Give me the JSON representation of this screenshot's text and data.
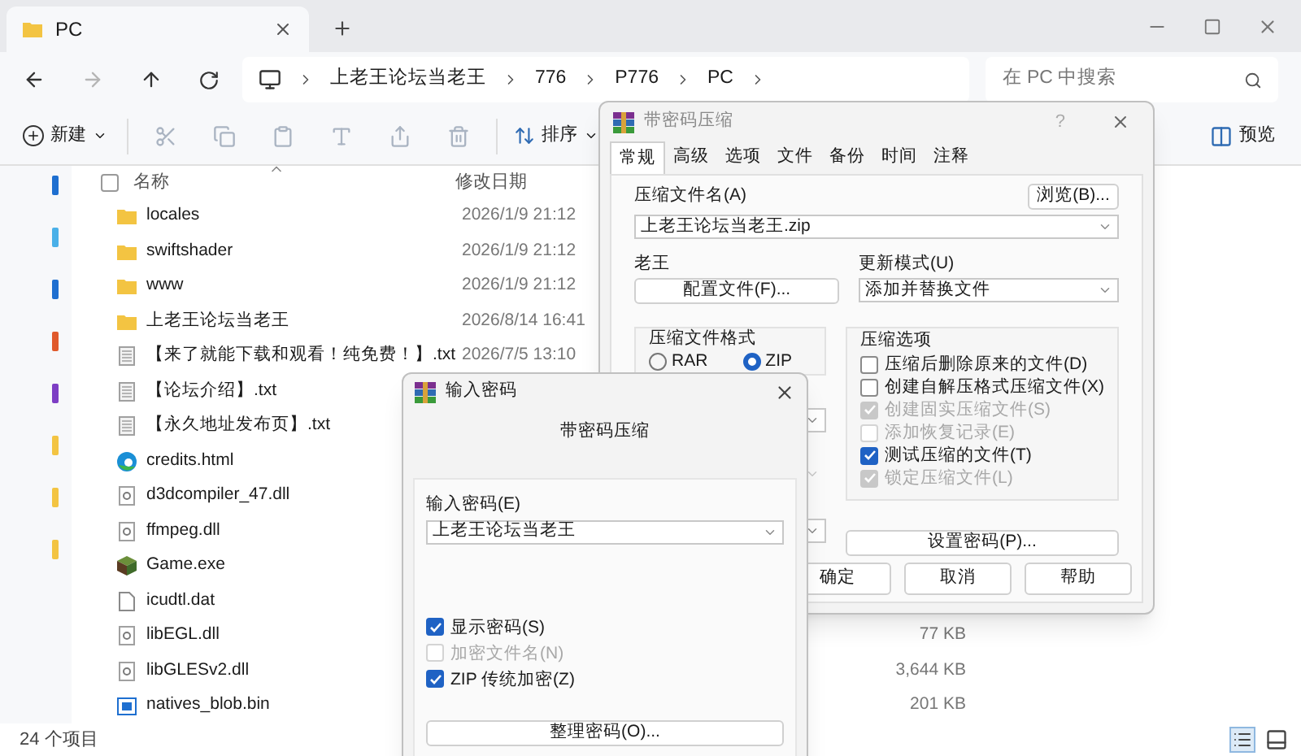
{
  "explorer": {
    "tab": {
      "title": "PC"
    },
    "address": {
      "path": [
        "上老王论坛当老王",
        "776",
        "P776",
        "PC"
      ]
    },
    "search": {
      "placeholder": "在 PC 中搜索"
    },
    "toolbar": {
      "new_label": "新建",
      "sort_label": "排序",
      "preview_label": "预览"
    },
    "select_all": {
      "checked": false
    },
    "columns": [
      "名称",
      "修改日期"
    ],
    "files": [
      {
        "name": "locales",
        "kind": "folder",
        "date": "2026/1/9 21:12"
      },
      {
        "name": "swiftshader",
        "kind": "folder",
        "date": "2026/1/9 21:12"
      },
      {
        "name": "www",
        "kind": "folder",
        "date": "2026/1/9 21:12"
      },
      {
        "name": "上老王论坛当老王",
        "kind": "folder",
        "date": "2026/8/14 16:41"
      },
      {
        "name": "【来了就能下载和观看！纯免费！】.txt",
        "kind": "text",
        "date": "2026/7/5 13:10"
      },
      {
        "name": "【论坛介绍】.txt",
        "kind": "text"
      },
      {
        "name": "【永久地址发布页】.txt",
        "kind": "text"
      },
      {
        "name": "credits.html",
        "kind": "web"
      },
      {
        "name": "d3dcompiler_47.dll",
        "kind": "dll"
      },
      {
        "name": "ffmpeg.dll",
        "kind": "dll"
      },
      {
        "name": "Game.exe",
        "kind": "exe"
      },
      {
        "name": "icudtl.dat",
        "kind": "blank"
      },
      {
        "name": "libEGL.dll",
        "kind": "dll",
        "size": "77 KB"
      },
      {
        "name": "libGLESv2.dll",
        "kind": "dll",
        "size": "3,644 KB"
      },
      {
        "name": "natives_blob.bin",
        "kind": "bin",
        "size": "201 KB"
      }
    ],
    "status": "24 个项目"
  },
  "archive_dialog": {
    "title": "带密码压缩",
    "help_glyph": "?",
    "tabs": [
      {
        "label": "常规",
        "selected": true
      },
      {
        "label": "高级",
        "selected": false
      },
      {
        "label": "选项",
        "selected": false
      },
      {
        "label": "文件",
        "selected": false
      },
      {
        "label": "备份",
        "selected": false
      },
      {
        "label": "时间",
        "selected": false
      },
      {
        "label": "注释",
        "selected": false
      }
    ],
    "archive_name_label": "压缩文件名(A)",
    "browse_button": "浏览(B)...",
    "archive_name": "上老王论坛当老王.zip",
    "profile_label": "老王",
    "profile_button": "配置文件(F)...",
    "update_label": "更新模式(U)",
    "update_mode": "添加并替换文件",
    "format_label": "压缩文件格式",
    "formats": [
      {
        "label": "RAR",
        "selected": false
      },
      {
        "label": "ZIP",
        "selected": true
      }
    ],
    "options_label": "压缩选项",
    "options": [
      {
        "label": "压缩后删除原来的文件(D)",
        "checked": false,
        "disabled": false
      },
      {
        "label": "创建自解压格式压缩文件(X)",
        "checked": false,
        "disabled": false
      },
      {
        "label": "创建固实压缩文件(S)",
        "checked": true,
        "disabled": true
      },
      {
        "label": "添加恢复记录(E)",
        "checked": false,
        "disabled": true
      },
      {
        "label": "测试压缩的文件(T)",
        "checked": true,
        "disabled": false
      },
      {
        "label": "锁定压缩文件(L)",
        "checked": true,
        "disabled": true
      }
    ],
    "password_button": "设置密码(P)...",
    "buttons": [
      "确定",
      "取消",
      "帮助"
    ]
  },
  "password_dialog": {
    "title": "输入密码",
    "subtitle": "带密码压缩",
    "field_label": "输入密码(E)",
    "password": "上老王论坛当老王",
    "options": [
      {
        "label": "显示密码(S)",
        "checked": true,
        "disabled": false
      },
      {
        "label": "加密文件名(N)",
        "checked": false,
        "disabled": true
      },
      {
        "label": "ZIP 传统加密(Z)",
        "checked": true,
        "disabled": false
      }
    ],
    "organize_button": "整理密码(O)..."
  }
}
